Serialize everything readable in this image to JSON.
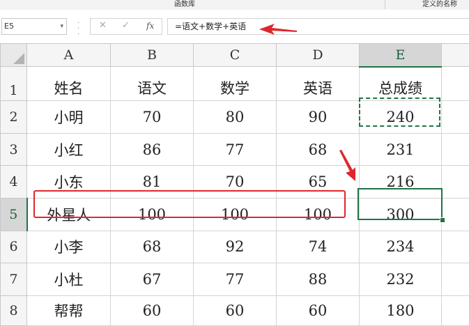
{
  "ribbon": {
    "group_label_1": "函数库",
    "group_label_2": "定义的名称"
  },
  "formula_bar": {
    "name_box": "E5",
    "name_box_dropdown": "▾",
    "cancel_glyph": "✕",
    "enter_glyph": "✓",
    "fx_label": "fx",
    "formula": "=语文+数学+英语"
  },
  "grid": {
    "column_headers": [
      "A",
      "B",
      "C",
      "D",
      "E"
    ],
    "row_headers": [
      "1",
      "2",
      "3",
      "4",
      "5",
      "6",
      "7",
      "8"
    ],
    "selected_cell": "E5",
    "rows": [
      [
        "姓名",
        "语文",
        "数学",
        "英语",
        "总成绩"
      ],
      [
        "小明",
        "70",
        "80",
        "90",
        "240"
      ],
      [
        "小红",
        "86",
        "77",
        "68",
        "231"
      ],
      [
        "小东",
        "81",
        "70",
        "65",
        "216"
      ],
      [
        "外星人",
        "100",
        "100",
        "100",
        "300"
      ],
      [
        "小李",
        "68",
        "92",
        "74",
        "234"
      ],
      [
        "小杜",
        "67",
        "77",
        "88",
        "232"
      ],
      [
        "帮帮",
        "60",
        "60",
        "60",
        "180"
      ]
    ]
  },
  "colors": {
    "accent": "#217346",
    "annotation": "#e0262d"
  },
  "icons": [
    "cancel-icon",
    "enter-icon",
    "insert-function-icon",
    "dropdown-arrow-icon"
  ]
}
